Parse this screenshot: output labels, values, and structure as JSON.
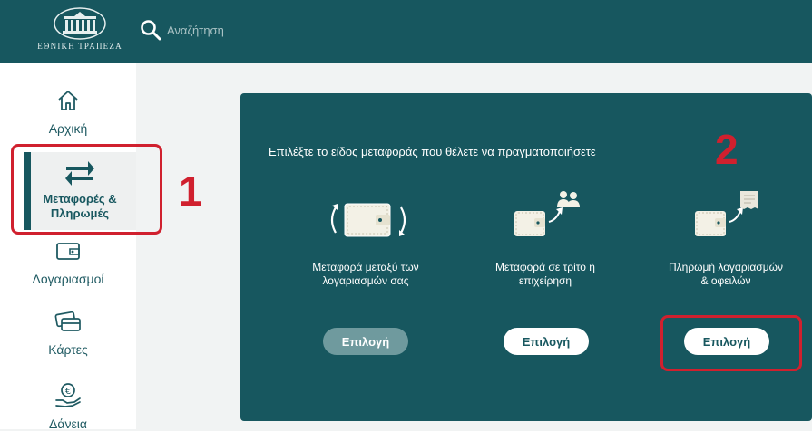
{
  "header": {
    "logo_text": "ΕΘΝΙΚΗ ΤΡΑΠΕΖΑ",
    "search_placeholder": "Αναζήτηση"
  },
  "sidebar": {
    "items": [
      {
        "label": "Αρχική",
        "icon": "home-icon"
      },
      {
        "label_line1": "Μεταφορές &",
        "label_line2": "Πληρωμές",
        "icon": "transfer-arrows-icon",
        "active": true
      },
      {
        "label": "Λογαριασμοί",
        "icon": "wallet-icon"
      },
      {
        "label": "Κάρτες",
        "icon": "cards-icon"
      },
      {
        "label": "Δάνεια",
        "icon": "loan-icon"
      }
    ]
  },
  "panel": {
    "title": "Επιλέξτε το είδος μεταφοράς που θέλετε να πραγματοποιήσετε",
    "options": [
      {
        "line1": "Μεταφορά μεταξύ των",
        "line2": "λογαριασμών σας",
        "button": "Επιλογή",
        "enabled": false,
        "icon": "wallet-cycle-icon"
      },
      {
        "line1": "Μεταφορά σε τρίτο ή",
        "line2": "επιχείρηση",
        "button": "Επιλογή",
        "enabled": true,
        "icon": "wallet-to-people-icon"
      },
      {
        "line1": "Πληρωμή λογαριασμών",
        "line2": "& οφειλών",
        "button": "Επιλογή",
        "enabled": true,
        "icon": "wallet-to-bill-icon"
      }
    ]
  },
  "annotations": {
    "one": "1",
    "two": "2"
  },
  "colors": {
    "brand": "#17575f",
    "annotation": "#d0202e",
    "disabled_button": "#6f9a9e"
  }
}
